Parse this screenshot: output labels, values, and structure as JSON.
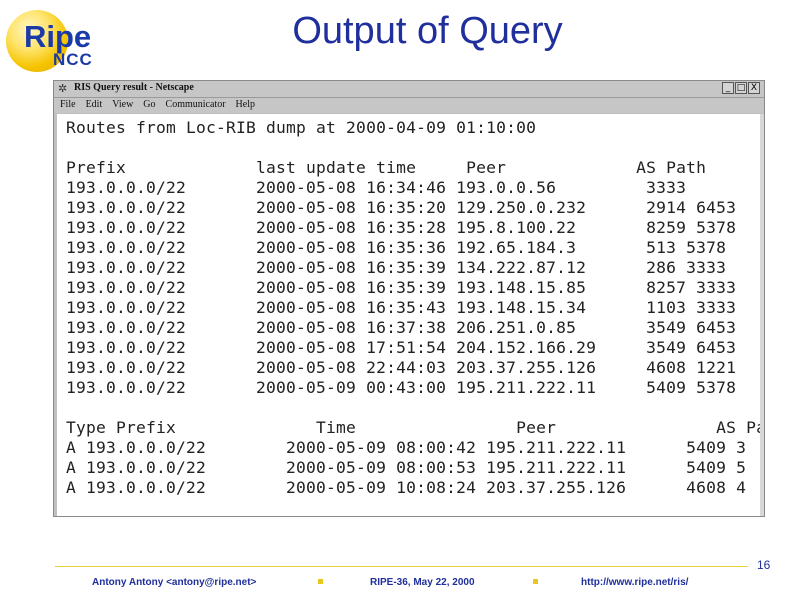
{
  "logo": {
    "name": "Ripe",
    "sub": "NCC"
  },
  "slide_title": "Output of Query",
  "window": {
    "title": "RIS Query result - Netscape",
    "menu": [
      "File",
      "Edit",
      "View",
      "Go",
      "Communicator",
      "Help"
    ],
    "controls": [
      "_",
      "□",
      "X"
    ]
  },
  "content": {
    "header": "Routes from Loc-RIB dump at 2000-04-09 01:10:00",
    "table1_header": "Prefix             last update time     Peer             AS Path",
    "table1_rows": [
      "193.0.0.0/22       2000-05-08 16:34:46 193.0.0.56         3333",
      "193.0.0.0/22       2000-05-08 16:35:20 129.250.0.232      2914 6453",
      "193.0.0.0/22       2000-05-08 16:35:28 195.8.100.22       8259 5378",
      "193.0.0.0/22       2000-05-08 16:35:36 192.65.184.3       513 5378",
      "193.0.0.0/22       2000-05-08 16:35:39 134.222.87.12      286 3333",
      "193.0.0.0/22       2000-05-08 16:35:39 193.148.15.85      8257 3333",
      "193.0.0.0/22       2000-05-08 16:35:43 193.148.15.34      1103 3333",
      "193.0.0.0/22       2000-05-08 16:37:38 206.251.0.85       3549 6453",
      "193.0.0.0/22       2000-05-08 17:51:54 204.152.166.29     3549 6453",
      "193.0.0.0/22       2000-05-08 22:44:03 203.37.255.126     4608 1221",
      "193.0.0.0/22       2000-05-09 00:43:00 195.211.222.11     5409 5378"
    ],
    "table2_header": "Type Prefix              Time                Peer                AS Pa",
    "table2_rows": [
      "A 193.0.0.0/22        2000-05-09 08:00:42 195.211.222.11      5409 3",
      "A 193.0.0.0/22        2000-05-09 08:00:53 195.211.222.11      5409 5",
      "A 193.0.0.0/22        2000-05-09 10:08:24 203.37.255.126      4608 4"
    ]
  },
  "footer": {
    "page_number": "16",
    "author": "Antony Antony <antony@ripe.net>",
    "meeting": "RIPE-36, May 22, 2000",
    "url": "http://www.ripe.net/ris/"
  },
  "colors": {
    "title": "#1f2f9c",
    "logo_yellow": "#f5c400",
    "rule": "#e6cf3a"
  }
}
